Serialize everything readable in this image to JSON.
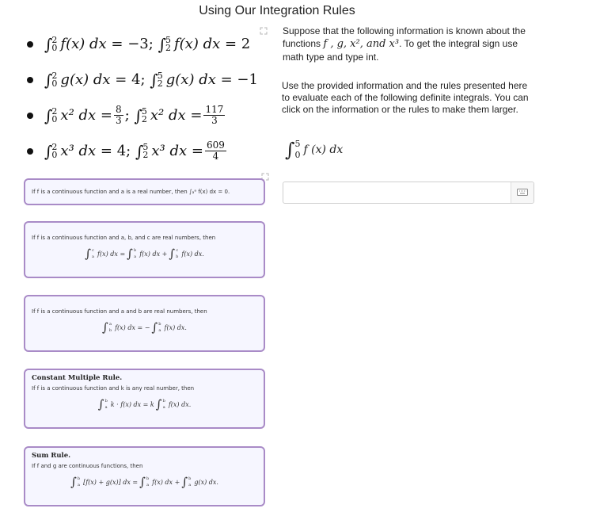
{
  "page": {
    "title": "Using Our Integration Rules"
  },
  "given_info": [
    {
      "left": {
        "lower": "0",
        "upper": "2",
        "integrand": "f(x) dx",
        "value": "= −3;"
      },
      "right": {
        "lower": "2",
        "upper": "5",
        "integrand": "f(x) dx",
        "value": "= 2"
      }
    },
    {
      "left": {
        "lower": "0",
        "upper": "2",
        "integrand": "g(x) dx",
        "value": "= 4;"
      },
      "right": {
        "lower": "2",
        "upper": "5",
        "integrand": "g(x) dx",
        "value": "= −1"
      }
    },
    {
      "left": {
        "lower": "0",
        "upper": "2",
        "integrand": "x² dx",
        "value_num": "8",
        "value_den": "3"
      },
      "right": {
        "lower": "2",
        "upper": "5",
        "integrand": "x² dx",
        "value_num": "117",
        "value_den": "3"
      }
    },
    {
      "left": {
        "lower": "0",
        "upper": "2",
        "integrand": "x³ dx",
        "value": "= 4;"
      },
      "right": {
        "lower": "2",
        "upper": "5",
        "integrand": "x³ dx",
        "value_num": "609",
        "value_den": "4"
      }
    }
  ],
  "prompt": {
    "intro_before": "Suppose that the following information is known about the functions ",
    "functions": "f , g, x², and x³",
    "intro_after": ". To get the integral sign use math type and type int.",
    "instructions": "Use the provided information and the rules presented here to evaluate each of the following definite integrals. You can click on the information or the rules to make them larger."
  },
  "question": {
    "lower": "0",
    "upper": "5",
    "integrand": "f (x) dx"
  },
  "answer": {
    "value": "",
    "placeholder": "",
    "keyboard_icon": "keyboard-icon"
  },
  "rules": [
    {
      "title": "",
      "text": "If f is a continuous function and a is a real number, then ∫ₐᵃ f(x) dx = 0.",
      "equation": ""
    },
    {
      "title": "",
      "text": "If f is a continuous function and a, b, and c are real numbers, then",
      "equation": "f(x) dx = ∫ f(x) dx + ∫ f(x) dx.",
      "eq_parts": [
        {
          "lower": "a",
          "upper": "c",
          "body": "f(x) dx ="
        },
        {
          "lower": "a",
          "upper": "b",
          "body": "f(x) dx +"
        },
        {
          "lower": "b",
          "upper": "c",
          "body": "f(x) dx."
        }
      ]
    },
    {
      "title": "",
      "text": "If f is a continuous function and a and b are real numbers, then",
      "eq_parts": [
        {
          "lower": "b",
          "upper": "a",
          "body": "f(x) dx = −"
        },
        {
          "lower": "a",
          "upper": "b",
          "body": "f(x) dx."
        }
      ]
    },
    {
      "title": "Constant Multiple Rule.",
      "text": "If f is a continuous function and k is any real number, then",
      "eq_parts": [
        {
          "lower": "a",
          "upper": "b",
          "body": "k · f(x) dx = k"
        },
        {
          "lower": "a",
          "upper": "b",
          "body": "f(x) dx."
        }
      ]
    },
    {
      "title": "Sum Rule.",
      "text": "If f and g are continuous functions, then",
      "eq_parts": [
        {
          "lower": "a",
          "upper": "b",
          "body": "[f(x) + g(x)] dx ="
        },
        {
          "lower": "a",
          "upper": "b",
          "body": "f(x) dx +"
        },
        {
          "lower": "a",
          "upper": "b",
          "body": "g(x) dx."
        }
      ]
    }
  ],
  "icons": {
    "expand": "expand-icon",
    "integral": "∫"
  },
  "colors": {
    "card_border": "#a98bc7",
    "card_bg": "#f6f6ff"
  }
}
